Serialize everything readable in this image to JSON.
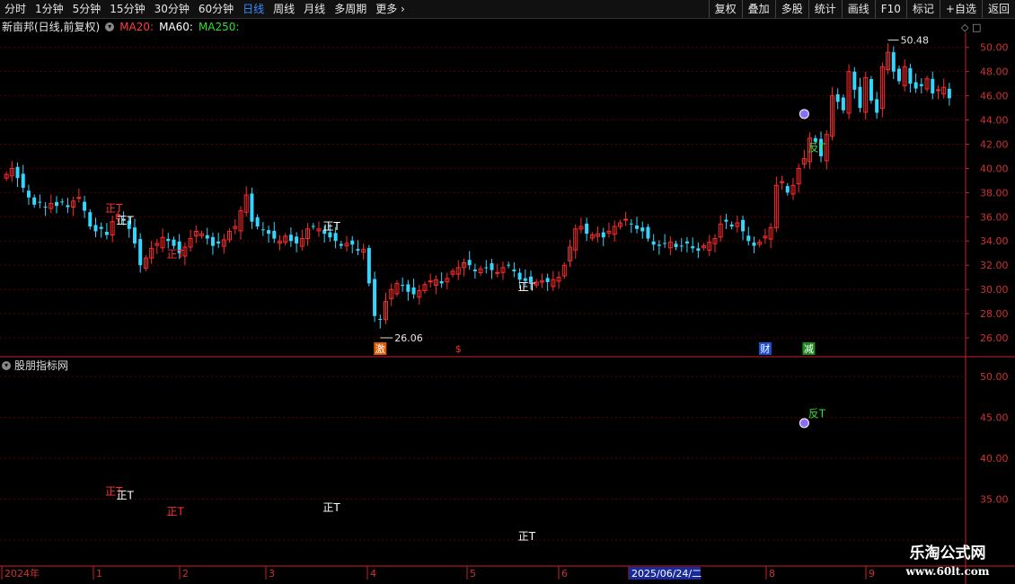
{
  "toolbar": {
    "periods": [
      "分时",
      "1分钟",
      "5分钟",
      "15分钟",
      "30分钟",
      "60分钟",
      "日线",
      "周线",
      "月线",
      "多周期",
      "更多"
    ],
    "active_period": "日线",
    "more_arrow": "›",
    "right_buttons": [
      "复权",
      "叠加",
      "多股",
      "统计",
      "画线",
      "F10",
      "标记",
      "+自选",
      "返回"
    ]
  },
  "main_panel": {
    "stock_label": "新亩邦(日线,前复权)",
    "ma20": "MA20:",
    "ma60": "MA60:",
    "ma250": "MA250:",
    "colors": {
      "ma20": "#ff3b3b",
      "ma60": "#ffffff",
      "ma250": "#33dd33",
      "up": "#ff2a2a",
      "down": "#33d6ff",
      "grid": "#5a0000",
      "axis": "#cc2222"
    },
    "max_label": "50.48",
    "min_label": "26.06",
    "corner_icons": "◇ □"
  },
  "sub_panel": {
    "title": "股朋指标网"
  },
  "chart_data": [
    {
      "type": "candlestick",
      "title": "新亩邦(日线,前复权)",
      "ylim": [
        25,
        51
      ],
      "y_ticks": [
        "50.00",
        "48.00",
        "46.00",
        "44.00",
        "42.00",
        "40.00",
        "38.00",
        "36.00",
        "34.00",
        "32.00",
        "30.00",
        "28.00",
        "26.00"
      ],
      "x_ticks": [
        "2024年",
        "1",
        "2",
        "3",
        "4",
        "5",
        "6",
        "2025/06/24/二",
        "8",
        "9"
      ],
      "close_series": [
        39.5,
        40.0,
        39.2,
        38.4,
        37.6,
        37.0,
        37.2,
        36.8,
        37.1,
        36.9,
        37.2,
        36.8,
        37.3,
        37.6,
        36.5,
        35.2,
        34.8,
        35.0,
        34.5,
        35.6,
        36.2,
        35.8,
        35.0,
        33.8,
        32.0,
        32.6,
        33.4,
        33.8,
        34.3,
        34.0,
        33.6,
        33.0,
        33.5,
        34.2,
        34.8,
        34.6,
        34.2,
        33.6,
        33.8,
        34.1,
        34.8,
        35.2,
        36.5,
        37.8,
        35.6,
        35.2,
        34.9,
        34.6,
        34.2,
        34.0,
        34.4,
        34.0,
        33.8,
        34.2,
        35.0,
        35.2,
        35.0,
        34.6,
        34.3,
        34.0,
        33.6,
        33.8,
        33.7,
        33.2,
        33.3,
        30.5,
        27.8,
        27.5,
        29.0,
        30.0,
        30.5,
        30.3,
        29.8,
        29.6,
        29.9,
        30.4,
        30.7,
        30.8,
        30.5,
        30.9,
        31.5,
        31.8,
        32.2,
        32.0,
        31.5,
        31.7,
        31.8,
        31.6,
        31.4,
        31.8,
        32.0,
        31.5,
        30.8,
        30.7,
        30.6,
        30.6,
        30.7,
        30.6,
        30.8,
        31.0,
        32.0,
        33.5,
        35.0,
        35.2,
        34.6,
        34.5,
        34.6,
        34.3,
        34.8,
        35.2,
        35.5,
        35.8,
        35.4,
        35.0,
        34.8,
        34.2,
        33.7,
        33.6,
        33.8,
        33.9,
        33.5,
        33.6,
        33.8,
        33.4,
        33.2,
        33.6,
        33.9,
        34.2,
        35.4,
        35.6,
        35.2,
        35.5,
        34.8,
        34.0,
        33.6,
        33.9,
        34.4,
        35.1,
        38.6,
        38.9,
        38.0,
        38.6,
        40.0,
        40.8,
        42.5,
        42.2,
        41.0,
        42.8,
        46.0,
        45.5,
        44.8,
        48.0,
        46.5,
        45.0,
        47.5,
        45.6,
        44.6,
        48.4,
        49.6,
        48.0,
        47.2,
        48.4,
        47.0,
        46.6,
        46.8,
        47.4,
        46.2,
        46.5,
        46.7,
        45.8
      ]
    }
  ],
  "signals": {
    "main": [
      {
        "text": "正T",
        "color": "#ff3030"
      },
      {
        "text": "正T",
        "color": "#ffffff"
      },
      {
        "text": "正T",
        "color": "#ff3030"
      },
      {
        "text": "正T",
        "color": "#ffffff"
      },
      {
        "text": "正T",
        "color": "#ffffff"
      },
      {
        "text": "反T",
        "color": "#33dd33"
      }
    ],
    "sub": [
      {
        "text": "正T",
        "color": "#ff3030"
      },
      {
        "text": "正T",
        "color": "#ffffff"
      },
      {
        "text": "正T",
        "color": "#ff3030"
      },
      {
        "text": "正T",
        "color": "#ffffff"
      },
      {
        "text": "正T",
        "color": "#ffffff"
      },
      {
        "text": "反T",
        "color": "#33dd33"
      }
    ],
    "sub_y_ticks": [
      "50.00",
      "45.00",
      "40.00",
      "35.00"
    ],
    "markers": [
      {
        "text": "激",
        "bg": "#e05a00",
        "color": "#ffffff"
      },
      {
        "text": "$",
        "bg": "",
        "color": "#ff3030"
      },
      {
        "text": "财",
        "bg": "#1d4fd0",
        "color": "#ffffff"
      },
      {
        "text": "减",
        "bg": "#1f8a1f",
        "color": "#ffffff"
      }
    ]
  },
  "watermark": {
    "line1": "乐淘公式网",
    "line2": "www.60lt.com"
  }
}
